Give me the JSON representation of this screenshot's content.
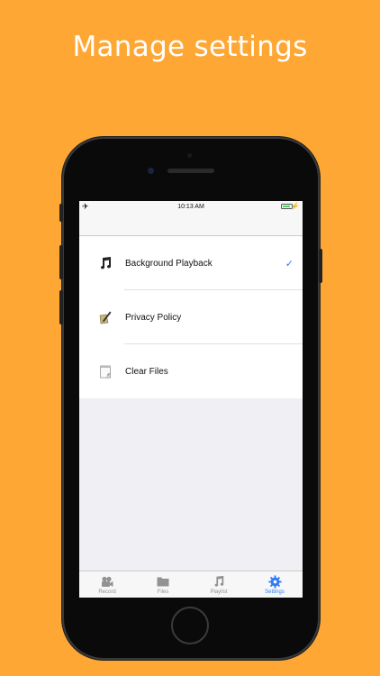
{
  "headline": "Manage settings",
  "colors": {
    "background": "#FFA734",
    "accent": "#2F7CF6",
    "tab_inactive": "#929292"
  },
  "status_bar": {
    "time": "10:13 AM",
    "airplane_icon": "airplane-icon",
    "battery_icon": "battery-icon",
    "battery_level": 0.85
  },
  "settings": {
    "items": [
      {
        "label": "Background Playback",
        "icon": "music-note-icon",
        "checked": true
      },
      {
        "label": "Privacy Policy",
        "icon": "pen-paper-icon",
        "checked": false
      },
      {
        "label": "Clear Files",
        "icon": "notepad-icon",
        "checked": false
      }
    ]
  },
  "tabs": [
    {
      "label": "Record",
      "icon": "camera-icon",
      "active": false
    },
    {
      "label": "Files",
      "icon": "folder-icon",
      "active": false
    },
    {
      "label": "Playlist",
      "icon": "music-note-icon",
      "active": false
    },
    {
      "label": "Settings",
      "icon": "gear-icon",
      "active": true
    }
  ]
}
